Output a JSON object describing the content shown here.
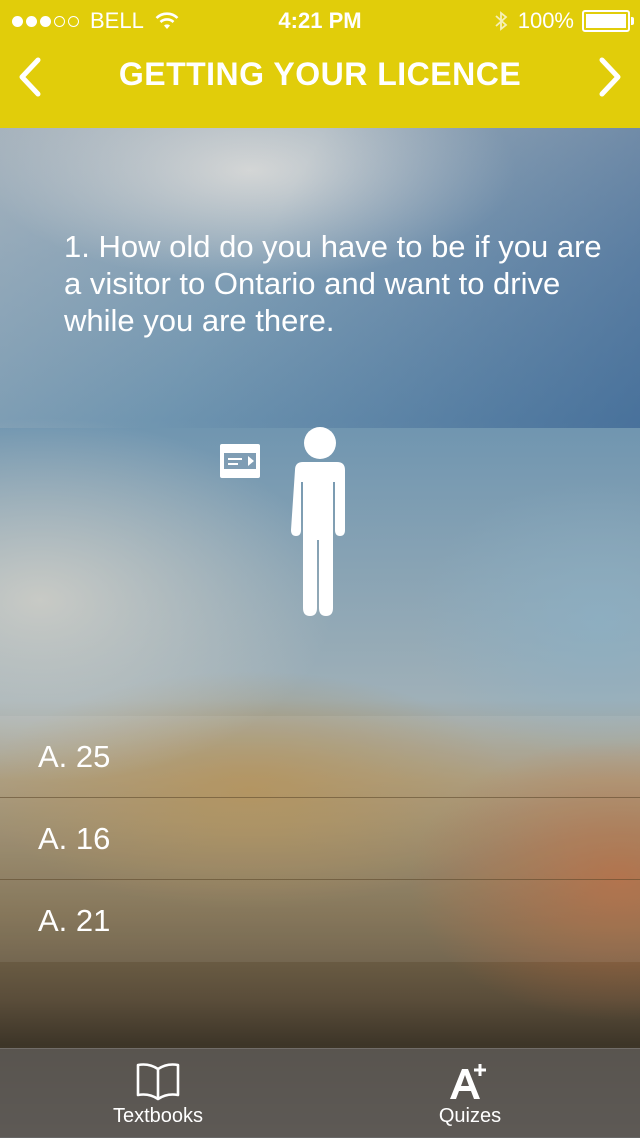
{
  "status_bar": {
    "carrier": "BELL",
    "signal_bars_filled": 3,
    "signal_bars_total": 5,
    "time": "4:21 PM",
    "battery_percent": "100%"
  },
  "nav": {
    "title": "GETTING YOUR LICENCE",
    "prev_icon": "chevron-left-icon",
    "next_icon": "chevron-right-icon"
  },
  "question": {
    "text": "1. How old do you have to be if you are a visitor to Ontario and want to drive while you are there.",
    "illustration": "person-with-license-card-icon"
  },
  "answers": [
    {
      "label": "A. 25"
    },
    {
      "label": "A. 16"
    },
    {
      "label": "A. 21"
    }
  ],
  "tabbar": {
    "tabs": [
      {
        "label": "Textbooks",
        "icon": "open-book-icon"
      },
      {
        "label": "Quizes",
        "icon": "a-plus-icon"
      }
    ]
  },
  "colors": {
    "header": "#e1cd0a",
    "text": "#ffffff"
  }
}
